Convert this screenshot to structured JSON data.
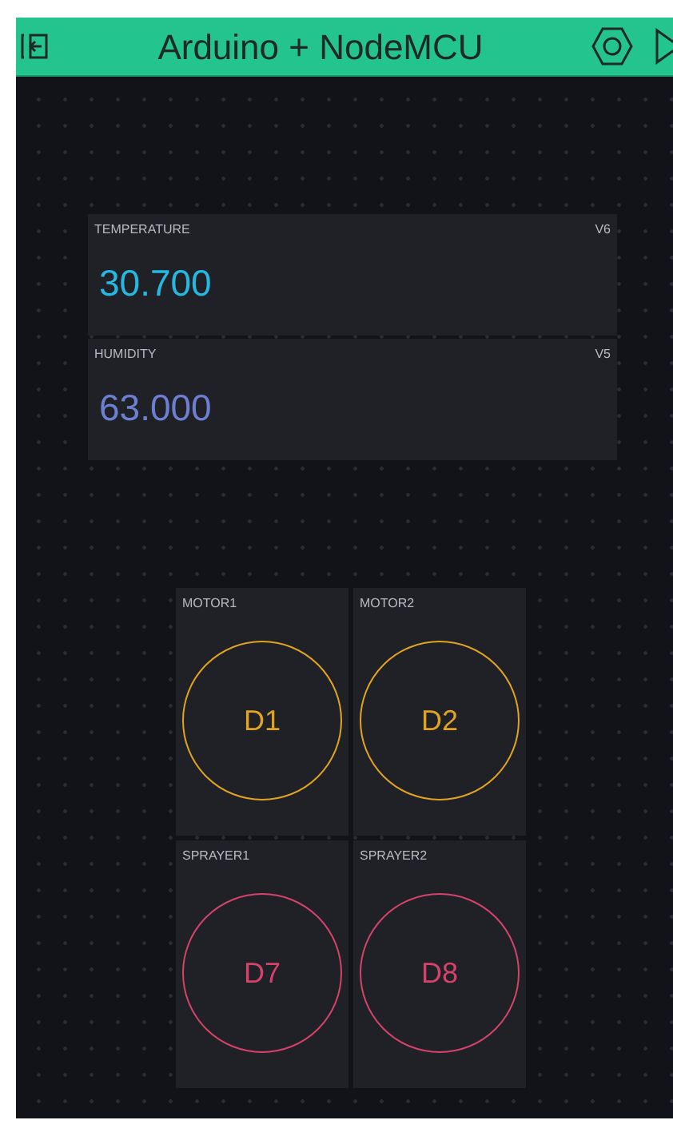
{
  "header": {
    "title": "Arduino + NodeMCU"
  },
  "displays": [
    {
      "label": "TEMPERATURE",
      "pin": "V6",
      "value": "30.700",
      "color": "#25b8e0"
    },
    {
      "label": "HUMIDITY",
      "pin": "V5",
      "value": "63.000",
      "color": "#6c7fd1"
    }
  ],
  "buttons": [
    {
      "label": "MOTOR1",
      "pin": "D1",
      "color": "#e0a41f"
    },
    {
      "label": "MOTOR2",
      "pin": "D2",
      "color": "#e0a41f"
    },
    {
      "label": "SPRAYER1",
      "pin": "D7",
      "color": "#d5426a"
    },
    {
      "label": "SPRAYER2",
      "pin": "D8",
      "color": "#d5426a"
    }
  ]
}
